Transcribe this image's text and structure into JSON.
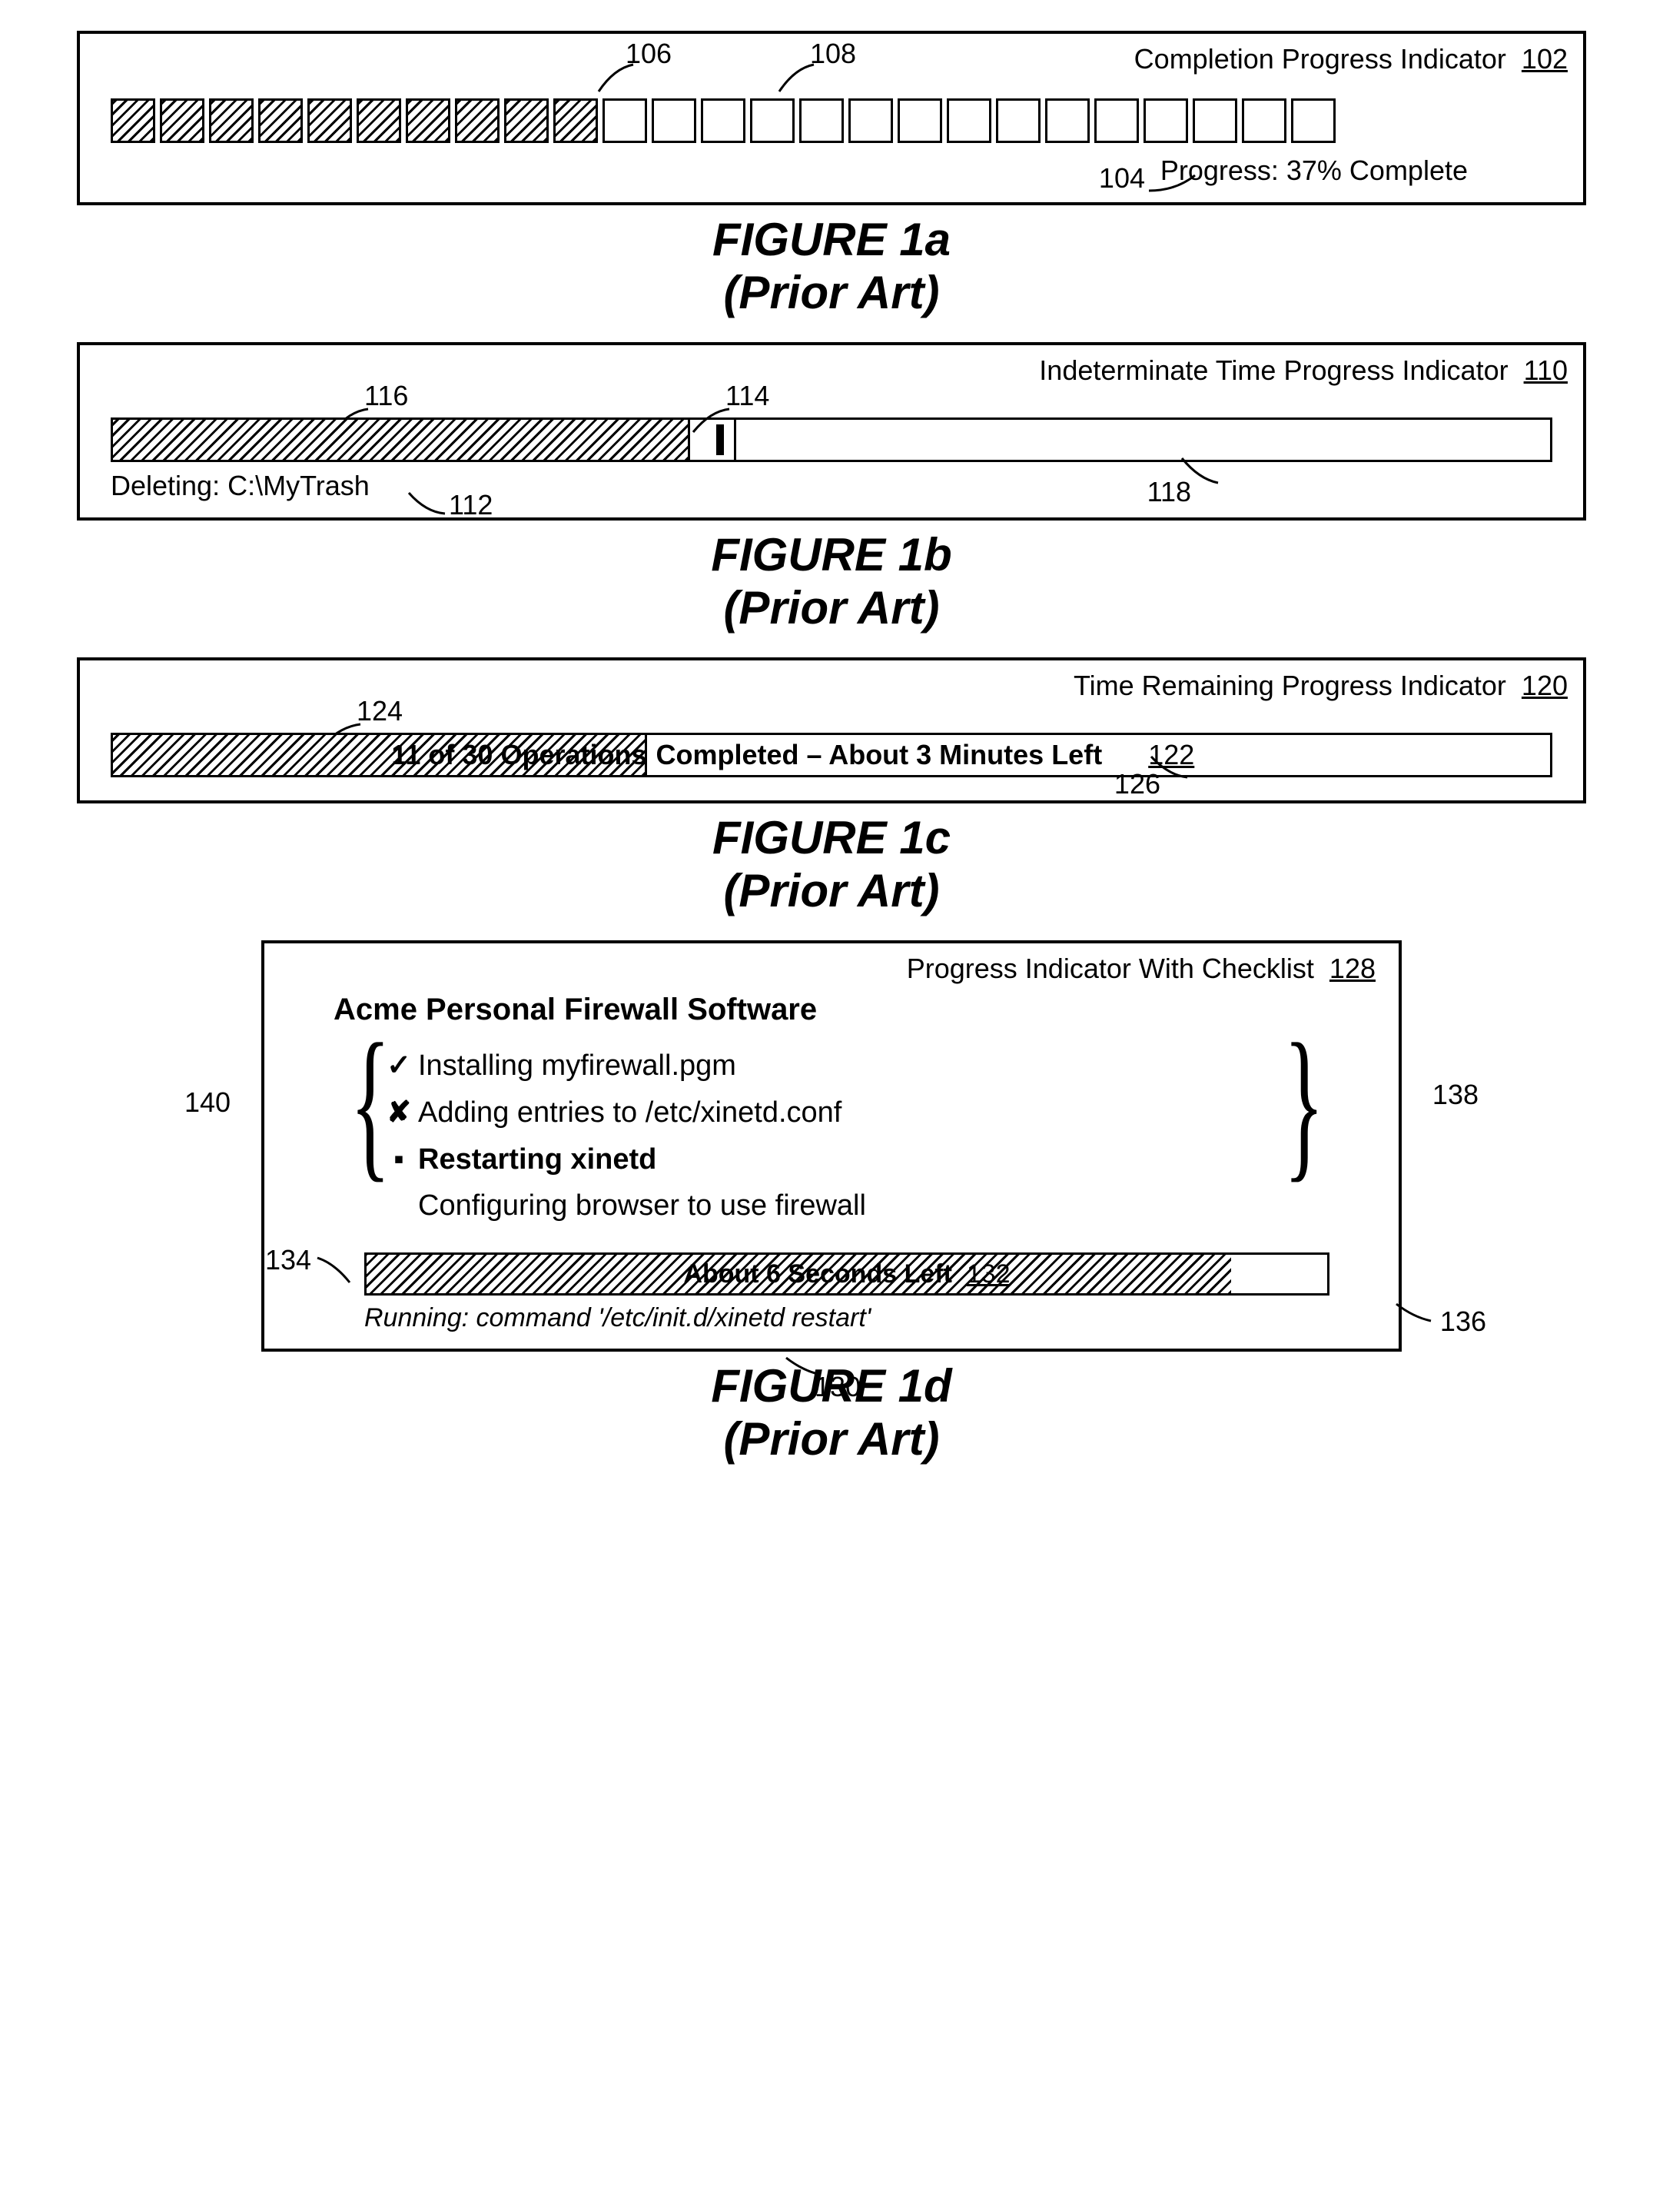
{
  "fig1a": {
    "title": "Completion Progress Indicator",
    "titleRef": "102",
    "filledCount": 10,
    "emptyCount": 15,
    "progressLabel": "Progress:  37% Complete",
    "ref106": "106",
    "ref108": "108",
    "ref104": "104",
    "caption1": "FIGURE 1a",
    "caption2": "(Prior Art)"
  },
  "fig1b": {
    "title": "Indeterminate Time Progress Indicator",
    "titleRef": "110",
    "fillPercent": 40,
    "sliderPercent": 42,
    "statusLabel": "Deleting:  C:\\MyTrash",
    "ref116": "116",
    "ref114": "114",
    "ref118": "118",
    "ref112": "112",
    "caption1": "FIGURE 1b",
    "caption2": "(Prior Art)"
  },
  "fig1c": {
    "title": "Time Remaining Progress Indicator",
    "titleRef": "120",
    "fillPercent": 37,
    "barLeft": "11 of 30 Operations",
    "barRight": "Completed – About 3 Minutes Left",
    "barRef": "122",
    "ref124": "124",
    "ref126": "126",
    "caption1": "FIGURE 1c",
    "caption2": "(Prior Art)"
  },
  "fig1d": {
    "title": "Progress Indicator With Checklist",
    "titleRef": "128",
    "software": "Acme Personal Firewall Software",
    "items": [
      {
        "icon": "✓",
        "text": "Installing myfirewall.pgm",
        "bold": false
      },
      {
        "icon": "✘",
        "text": "Adding entries to /etc/xinetd.conf",
        "bold": false
      },
      {
        "icon": "▪",
        "text": "Restarting xinetd",
        "bold": true
      },
      {
        "icon": "",
        "text": "Configuring browser to use firewall",
        "bold": false
      }
    ],
    "barFillPercent": 90,
    "barText": "About 6 Seconds Left",
    "barRef": "132",
    "status": "Running:  command '/etc/init.d/xinetd restart'",
    "ref140": "140",
    "ref138": "138",
    "ref134": "134",
    "ref136": "136",
    "ref130": "130",
    "caption1": "FIGURE 1d",
    "caption2": "(Prior Art)"
  }
}
